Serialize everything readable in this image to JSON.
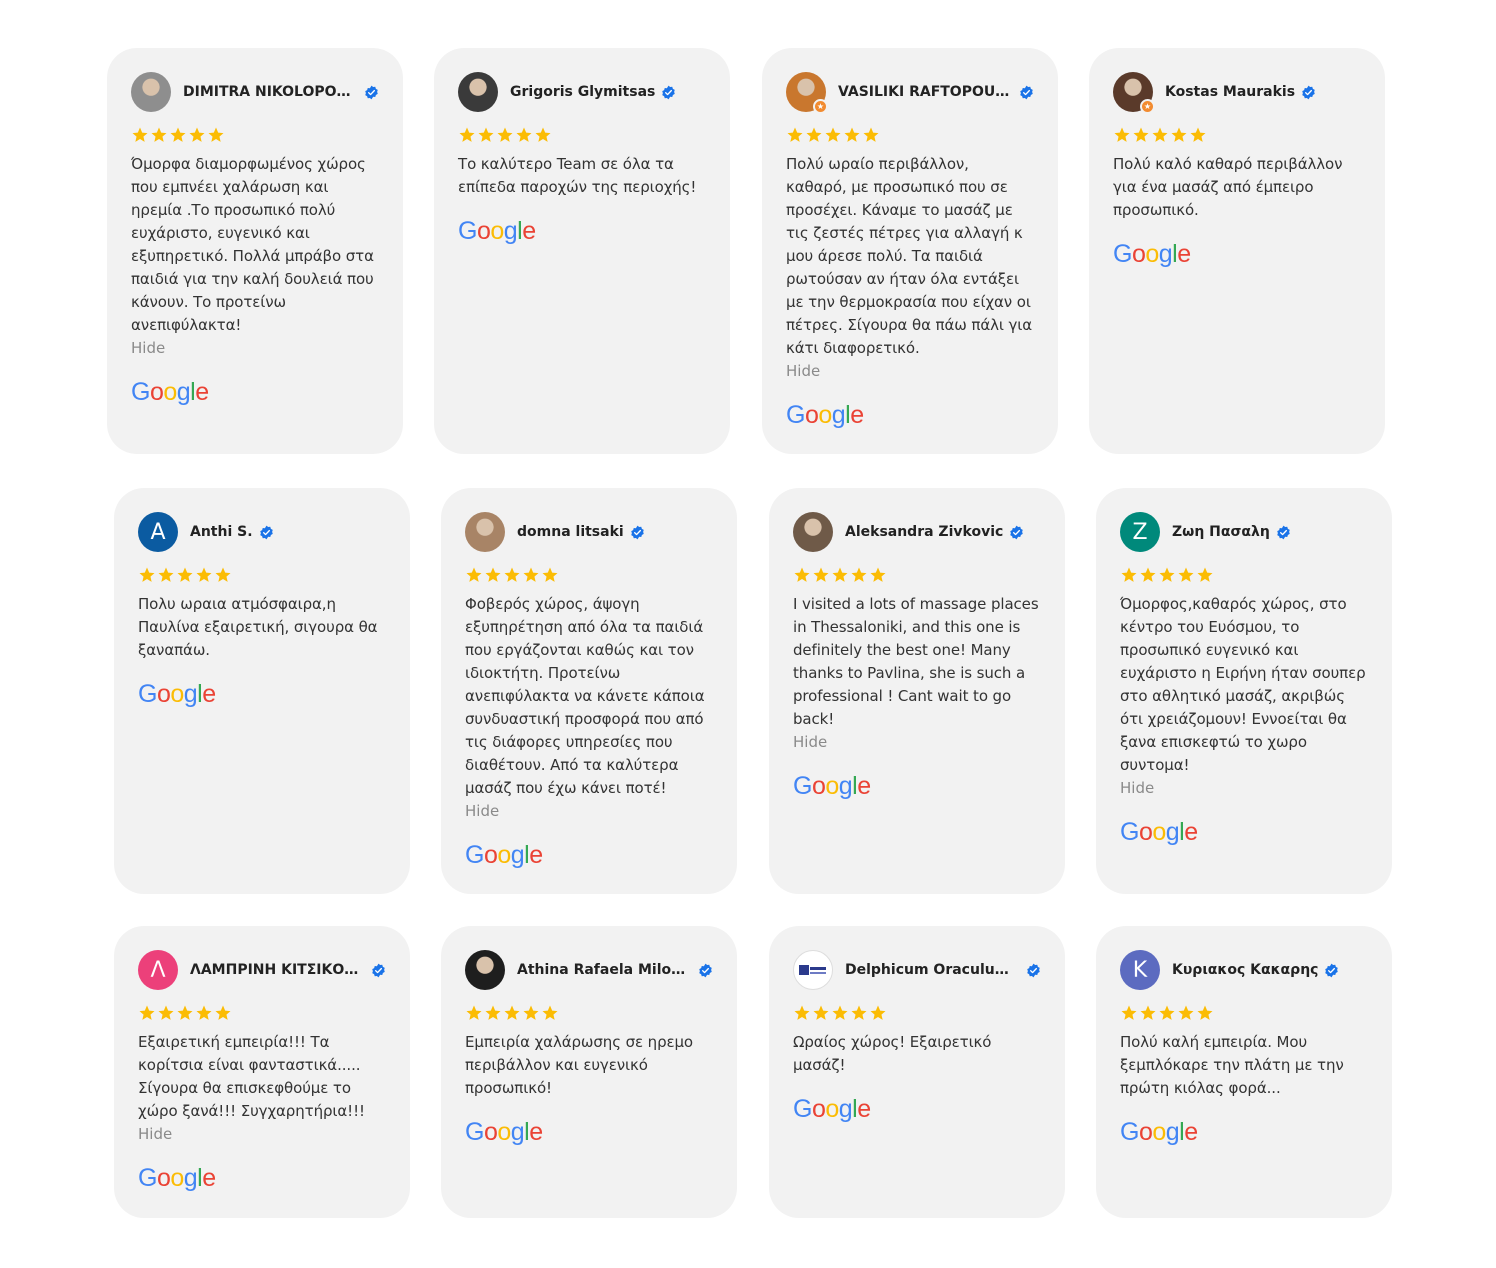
{
  "reviews": [
    {
      "name": "DIMITRA NIKOLOPOUL...",
      "avatar_type": "photo",
      "avatar_color": "#8e8e8e",
      "local_guide": false,
      "text": "Όμορφα διαμορφωμένος χώρος που εμπνέει χαλάρωση και ηρεμία .Το προσωπικό πολύ ευχάριστο, ευγενικό και εξυπηρετικό. Πολλά μπράβο στα παιδιά για την καλή δουλειά που κάνουν. Το προτείνω ανεπιφύλακτα!",
      "hide_label": "Hide"
    },
    {
      "name": "Grigoris Glymitsas",
      "avatar_type": "photo",
      "avatar_color": "#3a3a3a",
      "local_guide": false,
      "text": "Το καλύτερο Team σε όλα τα επίπεδα παροχών της περιοχής!",
      "hide_label": ""
    },
    {
      "name": "VASILIKI RAFTOPOULOU",
      "avatar_type": "photo",
      "avatar_color": "#c9772e",
      "local_guide": true,
      "text": "Πολύ ωραίο περιβάλλον, καθαρό, με προσωπικό που σε προσέχει. Κάναμε το μασάζ με τις ζεστές πέτρες για αλλαγή κ μου άρεσε πολύ. Τα παιδιά ρωτούσαν αν ήταν όλα εντάξει με την θερμοκρασία που είχαν οι πέτρες. Σίγουρα θα πάω πάλι για κάτι διαφορετικό.",
      "hide_label": "Hide"
    },
    {
      "name": "Kostas Maurakis",
      "avatar_type": "photo",
      "avatar_color": "#5a3a2a",
      "local_guide": true,
      "text": "Πολύ καλό καθαρό περιβάλλον για ένα μασάζ από έμπειρο προσωπικό.",
      "hide_label": ""
    },
    {
      "name": "Anthi S.",
      "avatar_type": "letter",
      "avatar_letter": "A",
      "avatar_color": "#0b5ba1",
      "local_guide": false,
      "text": "Πολυ ωραια ατμόσφαιρα,η Παυλίνα εξαιρετική, σιγουρα θα ξαναπάω.",
      "hide_label": ""
    },
    {
      "name": "domna litsaki",
      "avatar_type": "photo",
      "avatar_color": "#a88466",
      "local_guide": false,
      "text": "Φοβερός χώρος, άψογη εξυπηρέτηση από όλα τα παιδιά που εργάζονται καθώς και τον ιδιοκτήτη. Προτείνω ανεπιφύλακτα να κάνετε κάποια συνδυαστική προσφορά που από τις διάφορες υπηρεσίες που διαθέτουν. Από τα καλύτερα μασάζ που έχω κάνει ποτέ!",
      "hide_label": "Hide"
    },
    {
      "name": "Aleksandra Zivkovic",
      "avatar_type": "photo",
      "avatar_color": "#6f5a48",
      "local_guide": false,
      "text": "I visited a lots of massage places in Thessaloniki, and this one is definitely the best one! Many thanks to Pavlina, she is such a professional ! Cant wait to go back!",
      "hide_label": "Hide"
    },
    {
      "name": "Ζωη Πασαλη",
      "avatar_type": "letter",
      "avatar_letter": "Z",
      "avatar_color": "#00897b",
      "local_guide": false,
      "text": "Όμορφος,καθαρός χώρος, στο κέντρο του Ευόσμου, το προσωπικό ευγενικό και ευχάριστο η Ειρήνη ήταν σουπερ στο αθλητικό μασάζ, ακριβώς ότι χρειάζομουν! Εννοείται θα ξανα επισκεφτώ το χωρο συντομα!",
      "hide_label": "Hide"
    },
    {
      "name": "ΛΑΜΠΡΙΝΗ ΚΙΤΣΙΚΟΥΔΗ",
      "avatar_type": "letter",
      "avatar_letter": "Λ",
      "avatar_color": "#ec407a",
      "local_guide": false,
      "text": "Εξαιρετική εμπειρία!!! Τα κορίτσια είναι φανταστικά..... Σίγουρα θα επισκεφθούμε το χώρο ξανά!!! Συγχαρητήρια!!!",
      "hide_label": "Hide"
    },
    {
      "name": "Athina Rafaela Milousi",
      "avatar_type": "photo",
      "avatar_color": "#1e1e1e",
      "local_guide": false,
      "text": "Εμπειρία χαλάρωσης σε ηρεμο περιβάλλον και ευγενικό προσωπικό!",
      "hide_label": ""
    },
    {
      "name": "Delphicum Oraculum Ti...",
      "avatar_type": "logo",
      "avatar_color": "#ffffff",
      "local_guide": false,
      "text": "Ωραίος χώρος! Εξαιρετικό μασάζ!",
      "hide_label": ""
    },
    {
      "name": "Κυριακος Κακαρης",
      "avatar_type": "letter",
      "avatar_letter": "Κ",
      "avatar_color": "#5c6bc0",
      "local_guide": false,
      "text": "Πολύ καλή εμπειρία. Μου ξεμπλόκαρε την πλάτη με την πρώτη κιόλας φορά...",
      "hide_label": ""
    }
  ],
  "rating": 5,
  "source_logo": "Google",
  "colors": {
    "star": "#fbbc04",
    "verified": "#1a73e8",
    "card_bg": "#f2f2f2"
  }
}
